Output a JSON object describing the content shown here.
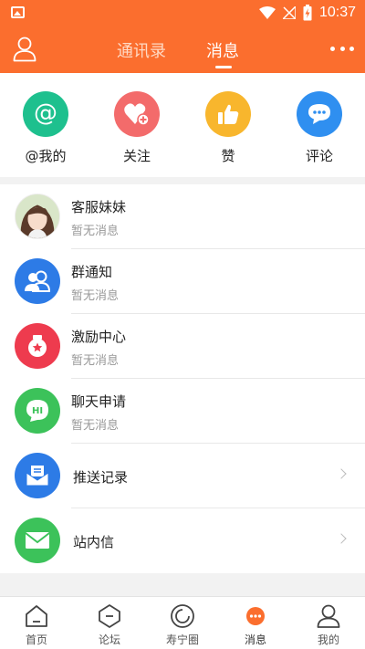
{
  "status_bar": {
    "time": "10:37"
  },
  "header": {
    "tabs": [
      {
        "label": "通讯录",
        "active": false
      },
      {
        "label": "消息",
        "active": true
      }
    ]
  },
  "quick_actions": [
    {
      "label": "@我的",
      "icon": "at-icon",
      "color": "#1ec08e"
    },
    {
      "label": "关注",
      "icon": "heart-plus-icon",
      "color": "#f36b6b"
    },
    {
      "label": "赞",
      "icon": "thumbs-up-icon",
      "color": "#f8b62d"
    },
    {
      "label": "评论",
      "icon": "comment-icon",
      "color": "#2f8ff0"
    }
  ],
  "conversations": [
    {
      "title": "客服妹妹",
      "subtitle": "暂无消息",
      "icon": "avatar-photo"
    },
    {
      "title": "群通知",
      "subtitle": "暂无消息",
      "icon": "group-icon",
      "color": "#2d7be6"
    },
    {
      "title": "激励中心",
      "subtitle": "暂无消息",
      "icon": "badge-icon",
      "color": "#ee3b4e"
    },
    {
      "title": "聊天申请",
      "subtitle": "暂无消息",
      "icon": "hi-chat-icon",
      "color": "#3cc25a"
    }
  ],
  "links": [
    {
      "title": "推送记录",
      "icon": "push-mail-icon",
      "color": "#2d7be6"
    },
    {
      "title": "站内信",
      "icon": "envelope-icon",
      "color": "#3cc25a"
    }
  ],
  "bottom_nav": [
    {
      "label": "首页",
      "icon": "home-icon",
      "active": false
    },
    {
      "label": "论坛",
      "icon": "forum-icon",
      "active": false
    },
    {
      "label": "寿宁圈",
      "icon": "circle-icon",
      "active": false
    },
    {
      "label": "消息",
      "icon": "message-icon",
      "active": true
    },
    {
      "label": "我的",
      "icon": "profile-icon",
      "active": false
    }
  ],
  "colors": {
    "brand": "#fb6e2e"
  }
}
